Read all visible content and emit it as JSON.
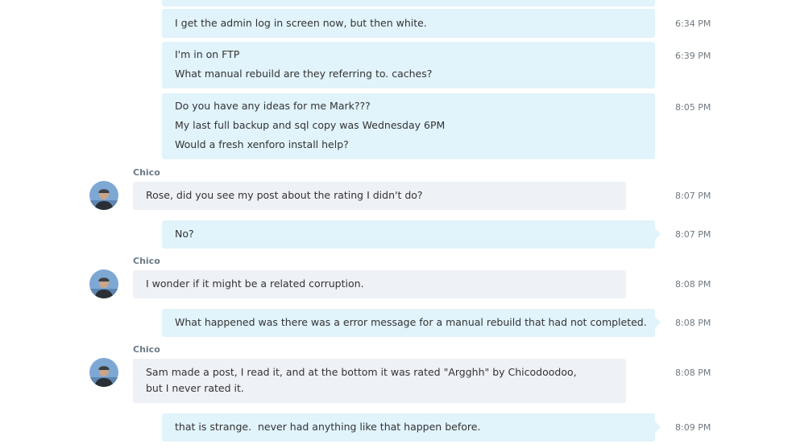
{
  "messages": [
    {
      "type": "out",
      "lines": [
        "I get the admin log in screen now, but then white."
      ],
      "time": "6:34 PM"
    },
    {
      "type": "out",
      "lines": [
        "I'm in on FTP",
        "What manual rebuild are they referring to. caches?"
      ],
      "time": "6:39 PM"
    },
    {
      "type": "out",
      "lines": [
        "Do you have any ideas for me Mark???",
        "My last full backup and sql copy was Wednesday 6PM",
        "Would a fresh xenforo install help?"
      ],
      "time": "8:05 PM"
    },
    {
      "type": "in",
      "sender": "Chico",
      "text": "Rose, did you see my post about the rating I didn't do?",
      "time": "8:07 PM"
    },
    {
      "type": "out",
      "lines": [
        "No?"
      ],
      "time": "8:07 PM"
    },
    {
      "type": "in",
      "sender": "Chico",
      "text": "I wonder if it might be a related corruption.",
      "time": "8:08 PM"
    },
    {
      "type": "out",
      "lines": [
        "What happened was there was a error message for a manual rebuild that had not completed."
      ],
      "time": "8:08 PM"
    },
    {
      "type": "in",
      "sender": "Chico",
      "text": "Sam made a post, I read it, and at the bottom it was rated \"Argghh\" by Chicodoodoo, but I never rated it.",
      "time": "8:08 PM"
    },
    {
      "type": "out",
      "lines": [
        "that is strange.  never had anything like that happen before."
      ],
      "time": "8:09 PM"
    }
  ],
  "avatar_icon": "user-avatar-icon"
}
